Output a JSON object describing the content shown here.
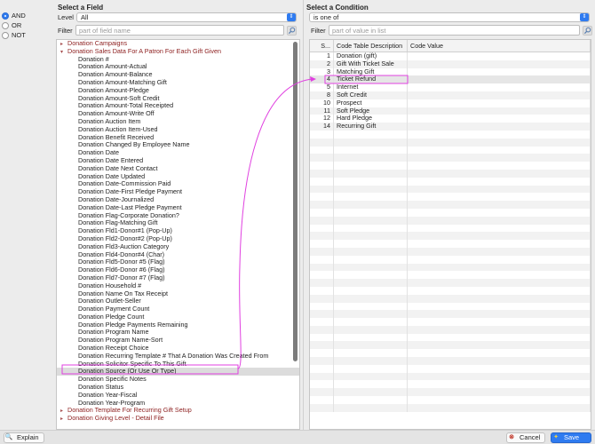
{
  "logic": {
    "options": [
      {
        "label": "AND",
        "selected": true
      },
      {
        "label": "OR",
        "selected": false
      },
      {
        "label": "NOT",
        "selected": false
      }
    ]
  },
  "field_panel": {
    "title": "Select a Field",
    "level_label": "Level",
    "level_value": "All",
    "filter_label": "Filter",
    "filter_placeholder": "part of field name",
    "rows": [
      {
        "kind": "group",
        "expanded": false,
        "label": "Donation Campaigns"
      },
      {
        "kind": "group",
        "expanded": true,
        "label": "Donation Sales Data For A Patron For Each Gift Given"
      },
      {
        "kind": "child",
        "label": "Donation #"
      },
      {
        "kind": "child",
        "label": "Donation Amount-Actual"
      },
      {
        "kind": "child",
        "label": "Donation Amount-Balance"
      },
      {
        "kind": "child",
        "label": "Donation Amount-Matching Gift"
      },
      {
        "kind": "child",
        "label": "Donation Amount-Pledge"
      },
      {
        "kind": "child",
        "label": "Donation Amount-Soft Credit"
      },
      {
        "kind": "child",
        "label": "Donation Amount-Total Receipted"
      },
      {
        "kind": "child",
        "label": "Donation Amount-Write Off"
      },
      {
        "kind": "child",
        "label": "Donation Auction Item"
      },
      {
        "kind": "child",
        "label": "Donation Auction Item-Used"
      },
      {
        "kind": "child",
        "label": "Donation Benefit Received"
      },
      {
        "kind": "child",
        "label": "Donation Changed By Employee Name"
      },
      {
        "kind": "child",
        "label": "Donation Date"
      },
      {
        "kind": "child",
        "label": "Donation Date Entered"
      },
      {
        "kind": "child",
        "label": "Donation Date Next Contact"
      },
      {
        "kind": "child",
        "label": "Donation Date Updated"
      },
      {
        "kind": "child",
        "label": "Donation Date-Commission Paid"
      },
      {
        "kind": "child",
        "label": "Donation Date-First Pledge Payment"
      },
      {
        "kind": "child",
        "label": "Donation Date-Journalized"
      },
      {
        "kind": "child",
        "label": "Donation Date-Last Pledge Payment"
      },
      {
        "kind": "child",
        "label": "Donation Flag-Corporate Donation?"
      },
      {
        "kind": "child",
        "label": "Donation Flag-Matching Gift"
      },
      {
        "kind": "child",
        "label": "Donation Fld1-Donor#1 (Pop-Up)"
      },
      {
        "kind": "child",
        "label": "Donation Fld2-Donor#2 (Pop-Up)"
      },
      {
        "kind": "child",
        "label": "Donation Fld3-Auction Category"
      },
      {
        "kind": "child",
        "label": "Donation Fld4-Donor#4 (Char)"
      },
      {
        "kind": "child",
        "label": "Donation Fld5-Donor #5 (Flag)"
      },
      {
        "kind": "child",
        "label": "Donation Fld6-Donor #6 (Flag)"
      },
      {
        "kind": "child",
        "label": "Donation Fld7-Donor #7 (Flag)"
      },
      {
        "kind": "child",
        "label": "Donation Household #"
      },
      {
        "kind": "child",
        "label": "Donation Name On Tax Receipt"
      },
      {
        "kind": "child",
        "label": "Donation Outlet-Seller"
      },
      {
        "kind": "child",
        "label": "Donation Payment Count"
      },
      {
        "kind": "child",
        "label": "Donation Pledge Count"
      },
      {
        "kind": "child",
        "label": "Donation Pledge Payments Remaining"
      },
      {
        "kind": "child",
        "label": "Donation Program Name"
      },
      {
        "kind": "child",
        "label": "Donation Program Name-Sort"
      },
      {
        "kind": "child",
        "label": "Donation Receipt Choice"
      },
      {
        "kind": "child",
        "label": "Donation Recurring Template # That A Donation Was Created From"
      },
      {
        "kind": "child",
        "label": "Donation Solicitor Specific To This Gift"
      },
      {
        "kind": "child",
        "label": "Donation Source (Or Use Or Type)",
        "selected": true
      },
      {
        "kind": "child",
        "label": "Donation Specific Notes"
      },
      {
        "kind": "child",
        "label": "Donation Status"
      },
      {
        "kind": "child",
        "label": "Donation Year-Fiscal"
      },
      {
        "kind": "child",
        "label": "Donation Year-Program"
      },
      {
        "kind": "group",
        "expanded": false,
        "label": "Donation Template For Recurring Gift Setup"
      },
      {
        "kind": "group",
        "expanded": false,
        "label": "Donation Giving Level - Detail File"
      }
    ]
  },
  "condition_panel": {
    "title": "Select a Condition",
    "condition_value": "is one of",
    "filter_label": "Filter",
    "filter_placeholder": "part of value in list",
    "columns": [
      "S...",
      "Code Table Description",
      "Code Value"
    ],
    "rows": [
      {
        "seq": "1",
        "desc": "Donation (gift)",
        "value": ""
      },
      {
        "seq": "2",
        "desc": "Gift With Ticket Sale",
        "value": ""
      },
      {
        "seq": "3",
        "desc": "Matching Gift",
        "value": ""
      },
      {
        "seq": "4",
        "desc": "Ticket Refund",
        "value": "",
        "highlight": true
      },
      {
        "seq": "5",
        "desc": "Internet",
        "value": ""
      },
      {
        "seq": "8",
        "desc": "Soft Credit",
        "value": ""
      },
      {
        "seq": "10",
        "desc": "Prospect",
        "value": ""
      },
      {
        "seq": "11",
        "desc": "Soft Pledge",
        "value": ""
      },
      {
        "seq": "12",
        "desc": "Hard Pledge",
        "value": ""
      },
      {
        "seq": "14",
        "desc": "Recurring Gift",
        "value": ""
      }
    ]
  },
  "footer": {
    "explain_label": "Explain",
    "cancel_label": "Cancel",
    "save_label": "Save"
  },
  "colors": {
    "accent": "#2f7bf0",
    "annotation": "#e040e0",
    "group_text": "#8c1d1d"
  }
}
